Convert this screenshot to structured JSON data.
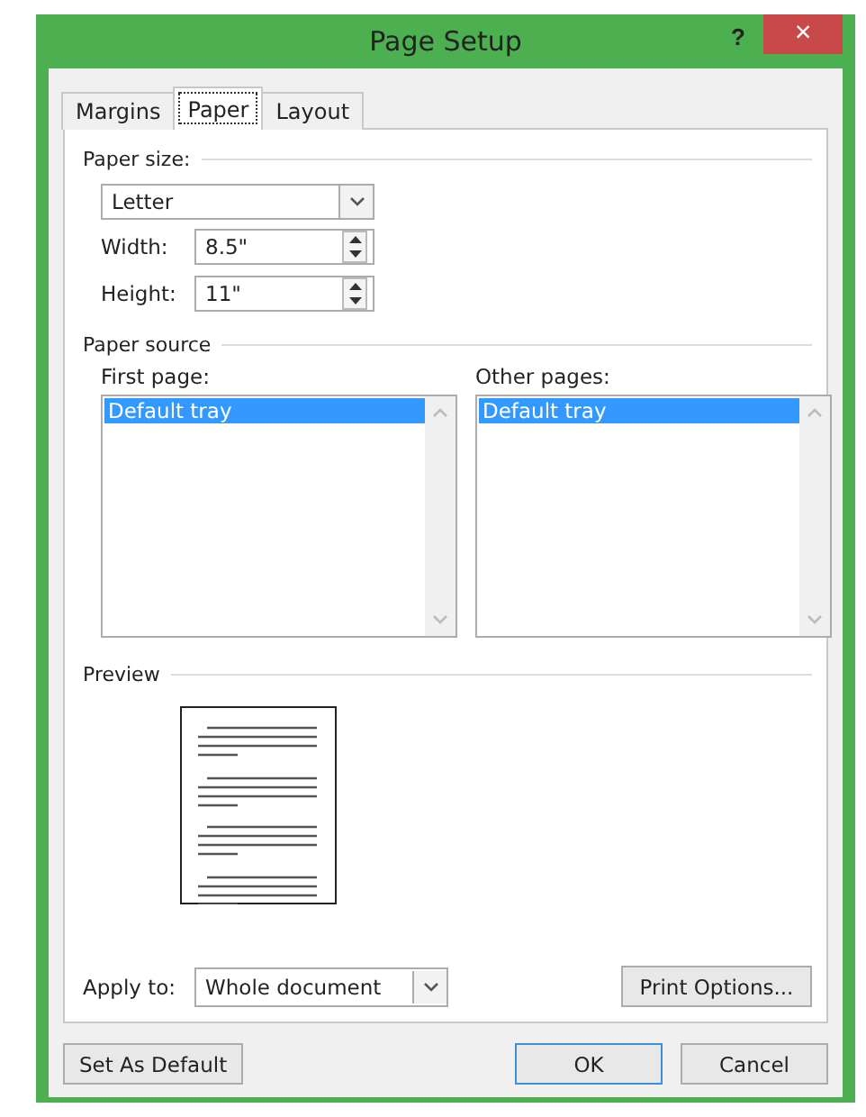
{
  "window": {
    "title": "Page Setup",
    "help": "?",
    "close": "×"
  },
  "tabs": [
    {
      "label": "Margins",
      "selected": false
    },
    {
      "label": "Paper",
      "selected": true
    },
    {
      "label": "Layout",
      "selected": false
    }
  ],
  "paper_size": {
    "heading": "Paper size:",
    "value": "Letter",
    "width_label": "Width:",
    "width": "8.5\"",
    "height_label": "Height:",
    "height": "11\""
  },
  "paper_source": {
    "heading": "Paper source",
    "lists": [
      {
        "label": "First page:",
        "items": [
          {
            "label": "Default tray",
            "selected": true
          }
        ]
      },
      {
        "label": "Other pages:",
        "items": [
          {
            "label": "Default tray",
            "selected": true
          }
        ]
      }
    ]
  },
  "preview": {
    "heading": "Preview"
  },
  "apply_to": {
    "label": "Apply to:",
    "value": "Whole document"
  },
  "print_options": "Print Options...",
  "buttons": [
    {
      "label": "Set As Default",
      "kind": "left",
      "focused": false
    },
    {
      "label": "OK",
      "kind": "right",
      "focused": true
    },
    {
      "label": "Cancel",
      "kind": "right",
      "focused": false
    }
  ]
}
